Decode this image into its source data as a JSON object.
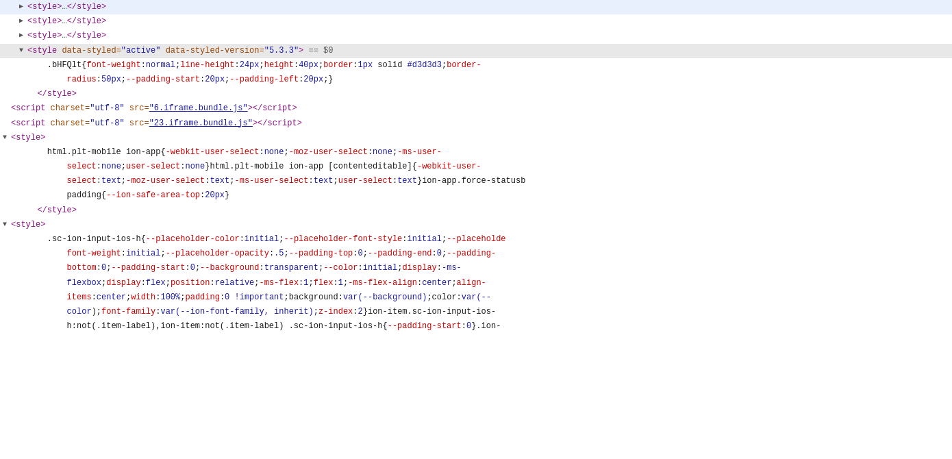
{
  "lines": [
    {
      "id": "line1",
      "indent": 0,
      "toggle": "collapsed",
      "highlighted": false,
      "content": "<style>…</style>"
    },
    {
      "id": "line2",
      "indent": 0,
      "toggle": "collapsed",
      "highlighted": false,
      "content": "<style>…</style>"
    },
    {
      "id": "line3",
      "indent": 0,
      "toggle": "collapsed",
      "highlighted": false,
      "content": "<style>…</style>"
    },
    {
      "id": "line4",
      "indent": 0,
      "toggle": "expanded",
      "highlighted": true,
      "content": "active_style_tag"
    },
    {
      "id": "line5",
      "indent": 1,
      "toggle": null,
      "highlighted": false,
      "content": "css_rule_bHFQlt"
    },
    {
      "id": "line6",
      "indent": 1,
      "toggle": null,
      "highlighted": false,
      "content": "css_continuation"
    },
    {
      "id": "line7",
      "indent": 1,
      "toggle": null,
      "highlighted": false,
      "content": "style_close"
    },
    {
      "id": "line8",
      "indent": 0,
      "toggle": null,
      "highlighted": false,
      "content": "script1"
    },
    {
      "id": "line9",
      "indent": 0,
      "toggle": null,
      "highlighted": false,
      "content": "script2"
    },
    {
      "id": "line10",
      "indent": 0,
      "toggle": "expanded",
      "highlighted": false,
      "content": "style_tag2"
    },
    {
      "id": "line11",
      "indent": 1,
      "toggle": null,
      "highlighted": false,
      "content": "css_html_plt_mobile"
    },
    {
      "id": "line12",
      "indent": 1,
      "toggle": null,
      "highlighted": false,
      "content": "css_html_plt_cont"
    },
    {
      "id": "line13",
      "indent": 1,
      "toggle": null,
      "highlighted": false,
      "content": "css_html_plt_cont2"
    },
    {
      "id": "line14",
      "indent": 1,
      "toggle": null,
      "highlighted": false,
      "content": "css_padding"
    },
    {
      "id": "line15",
      "indent": 1,
      "toggle": null,
      "highlighted": false,
      "content": "style_close2"
    },
    {
      "id": "line16",
      "indent": 0,
      "toggle": "expanded",
      "highlighted": false,
      "content": "style_tag3"
    },
    {
      "id": "line17",
      "indent": 1,
      "toggle": null,
      "highlighted": false,
      "content": "css_sc_ion1"
    },
    {
      "id": "line18",
      "indent": 1,
      "toggle": null,
      "highlighted": false,
      "content": "css_sc_ion2"
    },
    {
      "id": "line19",
      "indent": 1,
      "toggle": null,
      "highlighted": false,
      "content": "css_sc_ion3"
    },
    {
      "id": "line20",
      "indent": 1,
      "toggle": null,
      "highlighted": false,
      "content": "css_sc_ion4"
    },
    {
      "id": "line21",
      "indent": 1,
      "toggle": null,
      "highlighted": false,
      "content": "css_sc_ion5"
    },
    {
      "id": "line22",
      "indent": 1,
      "toggle": null,
      "highlighted": false,
      "content": "css_sc_ion6"
    },
    {
      "id": "line23",
      "indent": 1,
      "toggle": null,
      "highlighted": false,
      "content": "css_sc_ion7"
    }
  ],
  "colors": {
    "tag": "#881280",
    "attrName": "#994500",
    "attrValue": "#1a1aa6",
    "cssProperty": "#cc0000",
    "cssValue": "#1a1aa6",
    "highlight": "#e8e8e8",
    "text": "#1a1a1a"
  }
}
